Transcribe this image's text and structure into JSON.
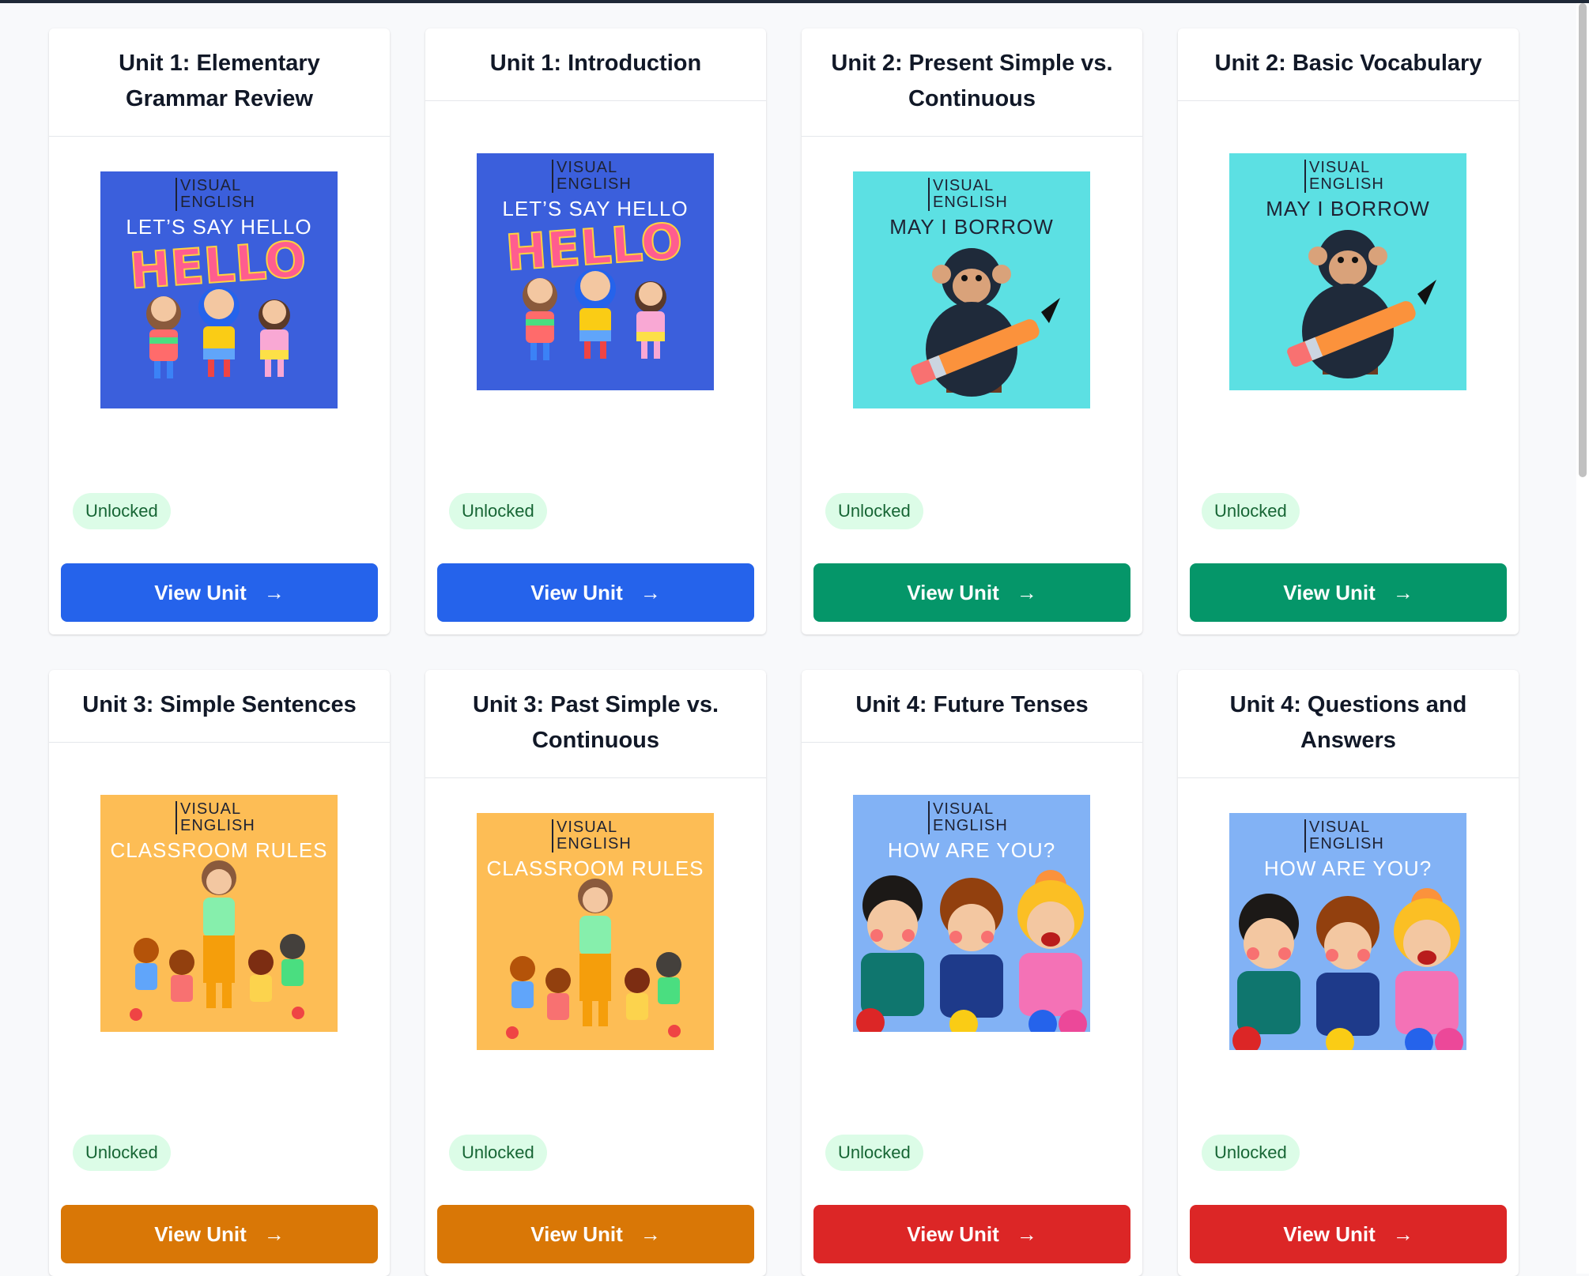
{
  "units": [
    {
      "title": "Unit 1: Elementary Grammar Review",
      "image_subtitle": "LET’S SAY HELLO",
      "image_theme": "hello",
      "status": "Unlocked",
      "button_label": "View Unit",
      "button_color": "#2563eb",
      "image_bg": "#3b5fdc"
    },
    {
      "title": "Unit 1: Introduction",
      "image_subtitle": "LET’S SAY HELLO",
      "image_theme": "hello",
      "status": "Unlocked",
      "button_label": "View Unit",
      "button_color": "#2563eb",
      "image_bg": "#3b5fdc"
    },
    {
      "title": "Unit 2: Present Simple vs. Continuous",
      "image_subtitle": "MAY I BORROW",
      "image_theme": "monkey",
      "status": "Unlocked",
      "button_label": "View Unit",
      "button_color": "#059669",
      "image_bg": "#5ce0e3"
    },
    {
      "title": "Unit 2: Basic Vocabulary",
      "image_subtitle": "MAY I BORROW",
      "image_theme": "monkey",
      "status": "Unlocked",
      "button_label": "View Unit",
      "button_color": "#059669",
      "image_bg": "#5ce0e3"
    },
    {
      "title": "Unit 3: Simple Sentences",
      "image_subtitle": "CLASSROOM RULES",
      "image_theme": "classroom",
      "status": "Unlocked",
      "button_label": "View Unit",
      "button_color": "#d97706",
      "image_bg": "#fdbd55"
    },
    {
      "title": "Unit 3: Past Simple vs. Continuous",
      "image_subtitle": "CLASSROOM RULES",
      "image_theme": "classroom",
      "status": "Unlocked",
      "button_label": "View Unit",
      "button_color": "#d97706",
      "image_bg": "#fdbd55"
    },
    {
      "title": "Unit 4: Future Tenses",
      "image_subtitle": "HOW ARE YOU?",
      "image_theme": "kids",
      "status": "Unlocked",
      "button_label": "View Unit",
      "button_color": "#dc2626",
      "image_bg": "#82b2f5"
    },
    {
      "title": "Unit 4: Questions and Answers",
      "image_subtitle": "HOW ARE YOU?",
      "image_theme": "kids",
      "status": "Unlocked",
      "button_label": "View Unit",
      "button_color": "#dc2626",
      "image_bg": "#82b2f5"
    }
  ],
  "brand_text": [
    "VISUAL",
    "ENGLISH"
  ],
  "hello_word": "HELLO",
  "arrow_icon": "arrow-right-icon"
}
